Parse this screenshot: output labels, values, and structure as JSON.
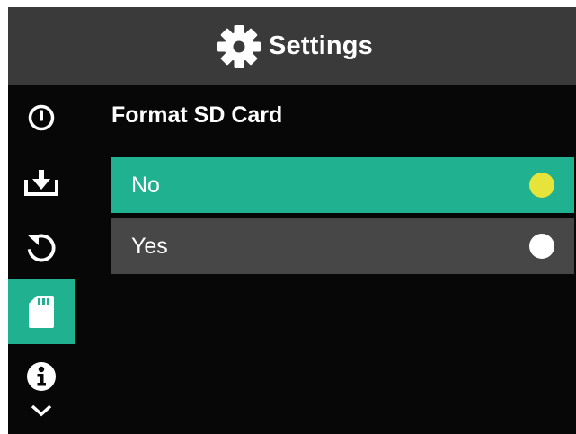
{
  "header": {
    "title": "Settings",
    "icon": "gear-icon"
  },
  "sidebar": {
    "items": [
      {
        "icon": "power-icon",
        "active": false
      },
      {
        "icon": "download-icon",
        "active": false
      },
      {
        "icon": "reset-icon",
        "active": false
      },
      {
        "icon": "sd-card-icon",
        "active": true
      },
      {
        "icon": "info-icon",
        "active": false
      },
      {
        "icon": "chevron-down-icon",
        "active": false
      }
    ]
  },
  "content": {
    "title": "Format SD Card",
    "options": [
      {
        "label": "No",
        "selected": true,
        "indicator_color": "#e6e33a"
      },
      {
        "label": "Yes",
        "selected": false,
        "indicator_color": "#ffffff"
      }
    ]
  },
  "colors": {
    "accent": "#20b190",
    "header_bg": "#3a3a3a",
    "screen_bg": "#070707",
    "unselected_option_bg": "#474747",
    "selected_indicator": "#e6e33a"
  }
}
